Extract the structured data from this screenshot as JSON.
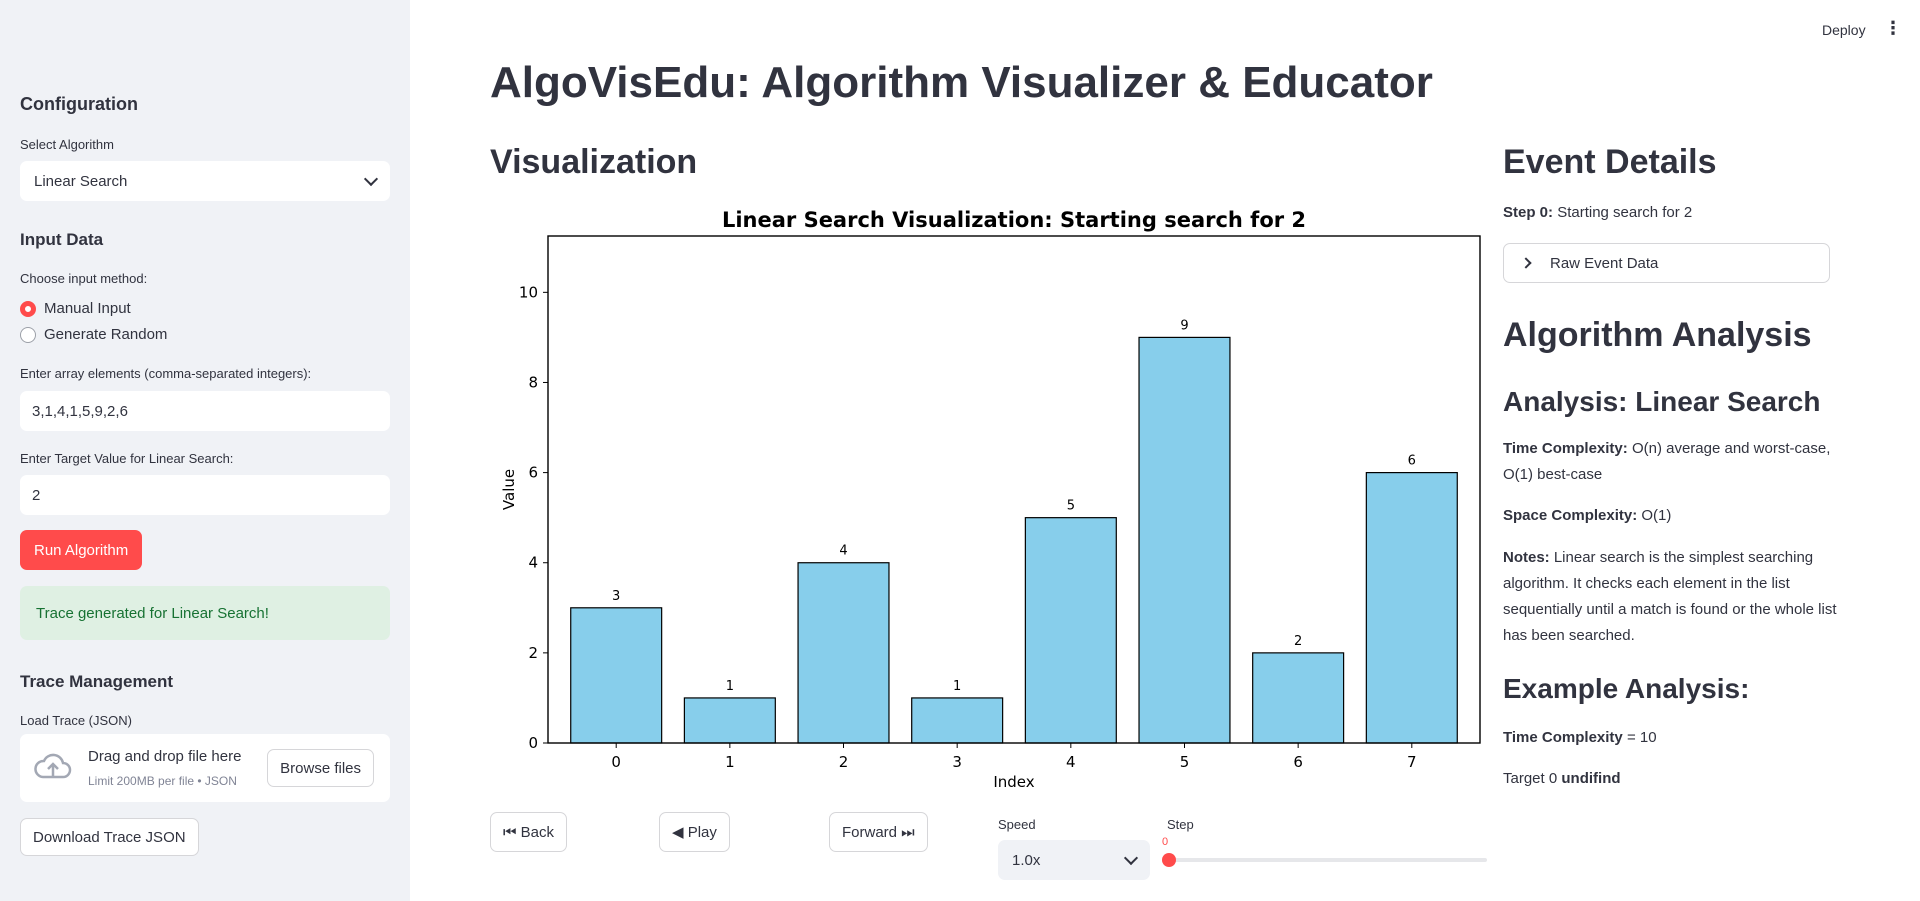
{
  "app": {
    "title": "AlgoVisEdu: Algorithm Visualizer & Educator",
    "deploy_label": "Deploy",
    "menu_icon": "kebab-menu-icon"
  },
  "sidebar": {
    "config_heading": "Configuration",
    "select_algorithm_label": "Select Algorithm",
    "selected_algorithm": "Linear Search",
    "input_data_heading": "Input Data",
    "input_method_label": "Choose input method:",
    "input_methods": [
      "Manual Input",
      "Generate Random"
    ],
    "selected_input_method": "Manual Input",
    "array_label": "Enter array elements (comma-separated integers):",
    "array_value": "3,1,4,1,5,9,2,6",
    "target_label": "Enter Target Value for Linear Search:",
    "target_value": "2",
    "run_button": "Run Algorithm",
    "success_message": "Trace generated for Linear Search!",
    "trace_heading": "Trace Management",
    "load_trace_label": "Load Trace (JSON)",
    "upload_title": "Drag and drop file here",
    "upload_limit": "Limit 200MB per file • JSON",
    "browse_button": "Browse files",
    "download_button": "Download Trace JSON",
    "accent_color": "#ff4b4b",
    "background_color": "#f0f2f6"
  },
  "visualization": {
    "heading": "Visualization",
    "controls": {
      "back": "⏮ Back",
      "play": "◀ Play",
      "forward": "Forward ⏭",
      "speed_label": "Speed",
      "speed_value": "1.0x",
      "step_label": "Step",
      "step_value": "0"
    }
  },
  "chart_data": {
    "type": "bar",
    "title": "Linear Search Visualization: Starting search for 2",
    "xlabel": "Index",
    "ylabel": "Value",
    "categories": [
      "0",
      "1",
      "2",
      "3",
      "4",
      "5",
      "6",
      "7"
    ],
    "values": [
      3,
      1,
      4,
      1,
      5,
      9,
      2,
      6
    ],
    "ylim": [
      0,
      11.25
    ],
    "yticks": [
      0,
      2,
      4,
      6,
      8,
      10
    ],
    "bar_color": "#87ceeb",
    "edge_color": "#000000",
    "grid": false
  },
  "event_details": {
    "heading": "Event Details",
    "step_label": "Step 0:",
    "step_text": "Starting search for 2",
    "raw_data_expander": "Raw Event Data"
  },
  "analysis": {
    "heading": "Algorithm Analysis",
    "subheading": "Analysis: Linear Search",
    "time_label": "Time Complexity:",
    "time_value": "O(n) average and worst-case, O(1) best-case",
    "space_label": "Space Complexity:",
    "space_value": "O(1)",
    "notes_label": "Notes:",
    "notes_value": "Linear search is the simplest searching algorithm. It checks each element in the list sequentially until a match is found or the whole list has been searched.",
    "example_heading": "Example Analysis:",
    "example_time_label": "Time Complexity",
    "example_time_value": "= 10",
    "example_target_text": "Target 0",
    "example_target_bold": "undifind"
  }
}
